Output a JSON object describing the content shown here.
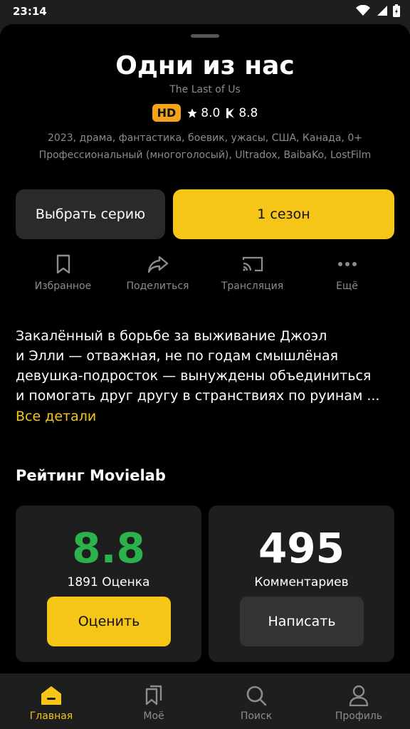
{
  "status": {
    "time": "23:14"
  },
  "movie": {
    "title": "Одни из нас",
    "original_title": "The Last of Us",
    "quality_badge": "HD",
    "rating_kp": "8.0",
    "rating_imdb": "8.8",
    "meta_line1": "2023, драма, фантастика, боевик, ужасы, США, Канада, 0+",
    "meta_line2": "Профессиональный (многоголосый), Ultradox, BaibaKo, LostFilm"
  },
  "buttons": {
    "choose_episode": "Выбрать серию",
    "season": "1 сезон"
  },
  "actions": [
    {
      "label": "Избранное",
      "icon": "bookmark-icon"
    },
    {
      "label": "Поделиться",
      "icon": "share-icon"
    },
    {
      "label": "Трансляция",
      "icon": "cast-icon"
    },
    {
      "label": "Ещё",
      "icon": "more-icon"
    }
  ],
  "description": {
    "lines": [
      "Закалённый в борьбе за выживание Джоэл",
      "и Элли — отважная, не по годам смышлёная",
      "девушка-подросток — вынуждены объединиться",
      "и помогать друг другу в странствиях по руинам ..."
    ],
    "more_link": "Все детали"
  },
  "rating_section": {
    "title": "Рейтинг Movielab",
    "score": "8.8",
    "score_count": "1891 Оценка",
    "rate_button": "Оценить",
    "comments_count": "495",
    "comments_label": "Комментариев",
    "write_button": "Написать"
  },
  "bottom_nav": [
    {
      "label": "Главная",
      "icon": "home-icon",
      "active": true
    },
    {
      "label": "Моё",
      "icon": "bookmarks-icon",
      "active": false
    },
    {
      "label": "Поиск",
      "icon": "search-icon",
      "active": false
    },
    {
      "label": "Профиль",
      "icon": "profile-icon",
      "active": false
    }
  ],
  "colors": {
    "accent": "#f5c518",
    "badge": "#f2a21b",
    "score_green": "#2bb24c",
    "background": "#000000",
    "card": "#1e1e1e"
  }
}
